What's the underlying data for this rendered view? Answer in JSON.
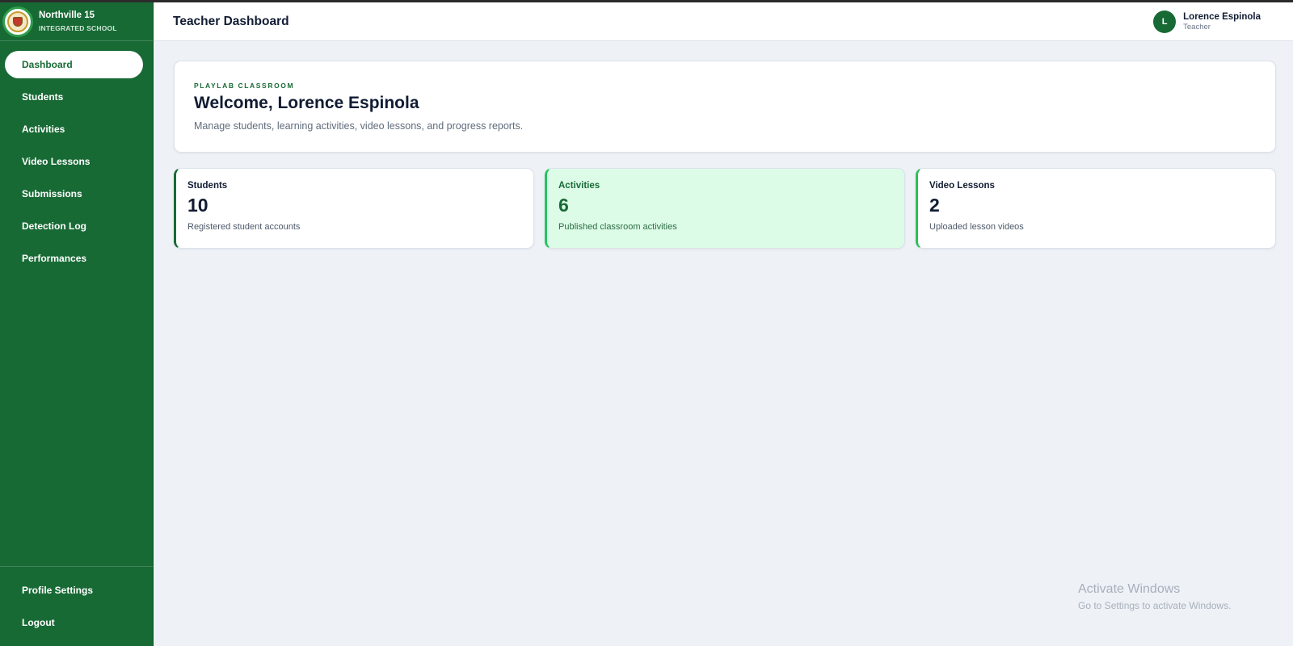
{
  "brand": {
    "name": "Northville 15",
    "subtitle": "INTEGRATED SCHOOL",
    "logo_icon": "school-seal-icon"
  },
  "sidebar": {
    "items": [
      {
        "label": "Dashboard",
        "active": true
      },
      {
        "label": "Students",
        "active": false
      },
      {
        "label": "Activities",
        "active": false
      },
      {
        "label": "Video Lessons",
        "active": false
      },
      {
        "label": "Submissions",
        "active": false
      },
      {
        "label": "Detection Log",
        "active": false
      },
      {
        "label": "Performances",
        "active": false
      }
    ],
    "bottom_items": [
      {
        "label": "Profile Settings"
      },
      {
        "label": "Logout"
      }
    ]
  },
  "header": {
    "title": "Teacher Dashboard",
    "user": {
      "initial": "L",
      "name": "Lorence Espinola",
      "role": "Teacher"
    }
  },
  "welcome": {
    "eyebrow": "PLAYLAB CLASSROOM",
    "title": "Welcome, Lorence Espinola",
    "description": "Manage students, learning activities, video lessons, and progress reports."
  },
  "stats": [
    {
      "label": "Students",
      "value": "10",
      "description": "Registered student accounts"
    },
    {
      "label": "Activities",
      "value": "6",
      "description": "Published classroom activities"
    },
    {
      "label": "Video Lessons",
      "value": "2",
      "description": "Uploaded lesson videos"
    }
  ],
  "watermark": {
    "title": "Activate Windows",
    "subtitle": "Go to Settings to activate Windows."
  },
  "colors": {
    "sidebar": "#186a35",
    "accent": "#186a35",
    "highlight_card": "#dcfce7",
    "background": "#eef2f7"
  }
}
